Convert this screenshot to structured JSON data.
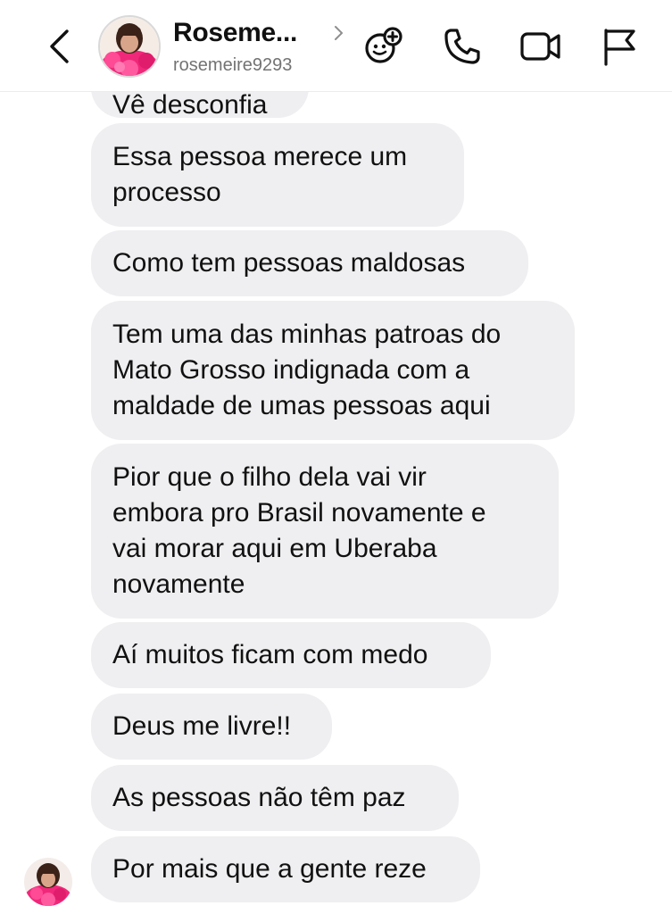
{
  "header": {
    "profile_name": "Roseme...",
    "username": "rosemeire9293",
    "icons": [
      "back-chevron-icon",
      "chevron-right-icon",
      "game-controller-icon",
      "phone-icon",
      "video-camera-icon",
      "flag-icon"
    ]
  },
  "messages": [
    {
      "text": "Vê desconfia"
    },
    {
      "text": "Essa pessoa merece um\nprocesso"
    },
    {
      "text": "Como tem pessoas maldosas"
    },
    {
      "text": "Tem uma das minhas patroas do\nMato Grosso indignada com a\nmaldade de umas pessoas aqui"
    },
    {
      "text": "Pior que o filho dela vai vir\nembora pro Brasil novamente e\nvai morar aqui em Uberaba\nnovamente"
    },
    {
      "text": "Aí muitos ficam com medo"
    },
    {
      "text": "Deus me livre!!"
    },
    {
      "text": "As pessoas não têm paz"
    },
    {
      "text": "Por mais que a gente reze"
    }
  ],
  "colors": {
    "bubble_bg": "#efeff1",
    "avatar_accent": "#f0287a",
    "muted_text": "#737373"
  }
}
